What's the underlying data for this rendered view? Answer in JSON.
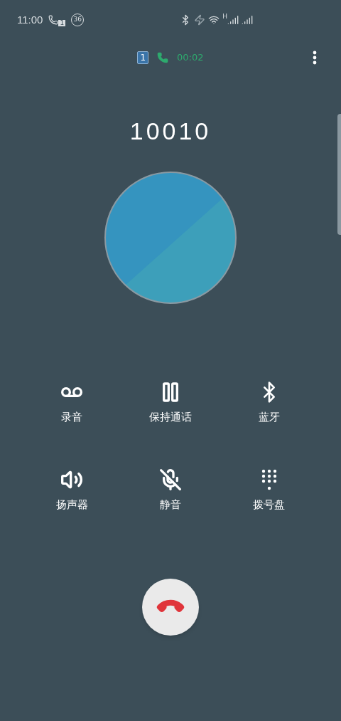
{
  "status_bar": {
    "time": "11:00",
    "call_sim": "1",
    "badge": "36",
    "network": "H"
  },
  "call": {
    "sim": "1",
    "duration": "00:02",
    "number": "10010"
  },
  "actions": [
    {
      "kind": "record",
      "label": "录音"
    },
    {
      "kind": "hold",
      "label": "保持通话"
    },
    {
      "kind": "bluetooth",
      "label": "蓝牙"
    },
    {
      "kind": "speaker",
      "label": "扬声器"
    },
    {
      "kind": "mute",
      "label": "静音"
    },
    {
      "kind": "keypad",
      "label": "拨号盘"
    }
  ]
}
